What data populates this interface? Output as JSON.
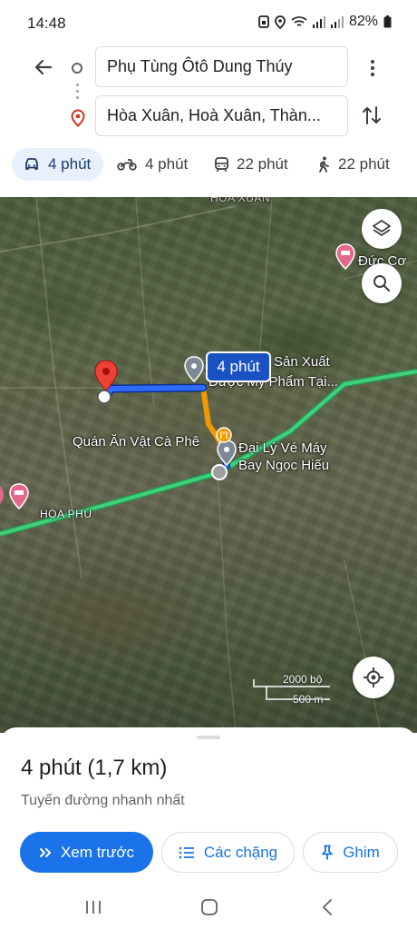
{
  "status_bar": {
    "time": "14:48",
    "battery": "82%",
    "icons": [
      "sim-icon",
      "location-icon",
      "wifi-icon",
      "signal-icon",
      "signal-icon",
      "battery-icon"
    ]
  },
  "directions": {
    "origin": "Phụ Tùng Ôtô Dung Thúy",
    "destination": "Hòa Xuân, Hoà Xuân, Thàn...",
    "modes": [
      {
        "name": "car",
        "icon": "car-icon",
        "label": "4 phút",
        "selected": true
      },
      {
        "name": "motorbike",
        "icon": "motorbike-icon",
        "label": "4 phút",
        "selected": false
      },
      {
        "name": "transit",
        "icon": "transit-icon",
        "label": "22 phút",
        "selected": false
      },
      {
        "name": "walk",
        "icon": "walk-icon",
        "label": "22 phút",
        "selected": false
      }
    ]
  },
  "map": {
    "time_bubble": "4 phút",
    "labels": {
      "place_top_right": "Đức Cơ",
      "place_production_1": "Sản Xuất",
      "place_production_2": "Dược Mỹ Phẩm Tại...",
      "restaurant": "Quán Ăn Vật Cà Phê",
      "agency_1": "Đại Lý Vé Máy",
      "agency_2": "Bay Ngọc Hiếu",
      "area": "HÒA PHÚ",
      "road_top": "HÒA XUÂN"
    },
    "scale": {
      "imperial": "2000 bộ",
      "metric": "500 m"
    },
    "route_color": "#1a52c4",
    "highway_color": "#3dd17a",
    "segment_color": "#f29900"
  },
  "sheet": {
    "duration": "4 phút",
    "distance": "(1,7 km)",
    "description": "Tuyến đường nhanh nhất",
    "buttons": {
      "preview": "Xem trước",
      "stops": "Các chặng",
      "pin": "Ghim"
    },
    "accent": "#1a73e8"
  }
}
